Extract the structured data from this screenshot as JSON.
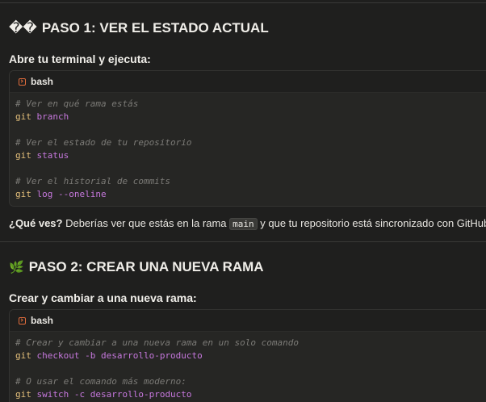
{
  "step1": {
    "emoji": "��",
    "title": "PASO 1: VER EL ESTADO ACTUAL",
    "intro": "Abre tu terminal y ejecuta:",
    "code_lang": "bash",
    "code_lines": [
      {
        "type": "comment",
        "text": "# Ver en qué rama estás"
      },
      {
        "type": "cmd",
        "cmd": "git",
        "args": " branch"
      },
      {
        "type": "blank"
      },
      {
        "type": "comment",
        "text": "# Ver el estado de tu repositorio"
      },
      {
        "type": "cmd",
        "cmd": "git",
        "args": " status"
      },
      {
        "type": "blank"
      },
      {
        "type": "comment",
        "text": "# Ver el historial de commits"
      },
      {
        "type": "cmd",
        "cmd": "git",
        "args": " log --oneline"
      }
    ],
    "question_bold": "¿Qué ves?",
    "question_text_1": " Deberías ver que estás en la rama ",
    "question_code": "main",
    "question_text_2": " y que tu repositorio está sincronizado con GitHub."
  },
  "step2": {
    "emoji": "🌿",
    "title": "PASO 2: CREAR UNA NUEVA RAMA",
    "intro": "Crear y cambiar a una nueva rama:",
    "code_lang": "bash",
    "code_lines": [
      {
        "type": "comment",
        "text": "# Crear y cambiar a una nueva rama en un solo comando"
      },
      {
        "type": "cmd",
        "cmd": "git",
        "args": " checkout -b desarrollo-producto"
      },
      {
        "type": "blank"
      },
      {
        "type": "comment",
        "text": "# O usar el comando más moderno:"
      },
      {
        "type": "cmd",
        "cmd": "git",
        "args": " switch -c desarrollo-producto"
      }
    ]
  },
  "colors": {
    "background": "#1f1f1e",
    "code_bg": "#262624",
    "comment": "#7c7b77",
    "keyword": "#e5c07b",
    "argument": "#c678dd",
    "icon_accent": "#e06c3c"
  }
}
